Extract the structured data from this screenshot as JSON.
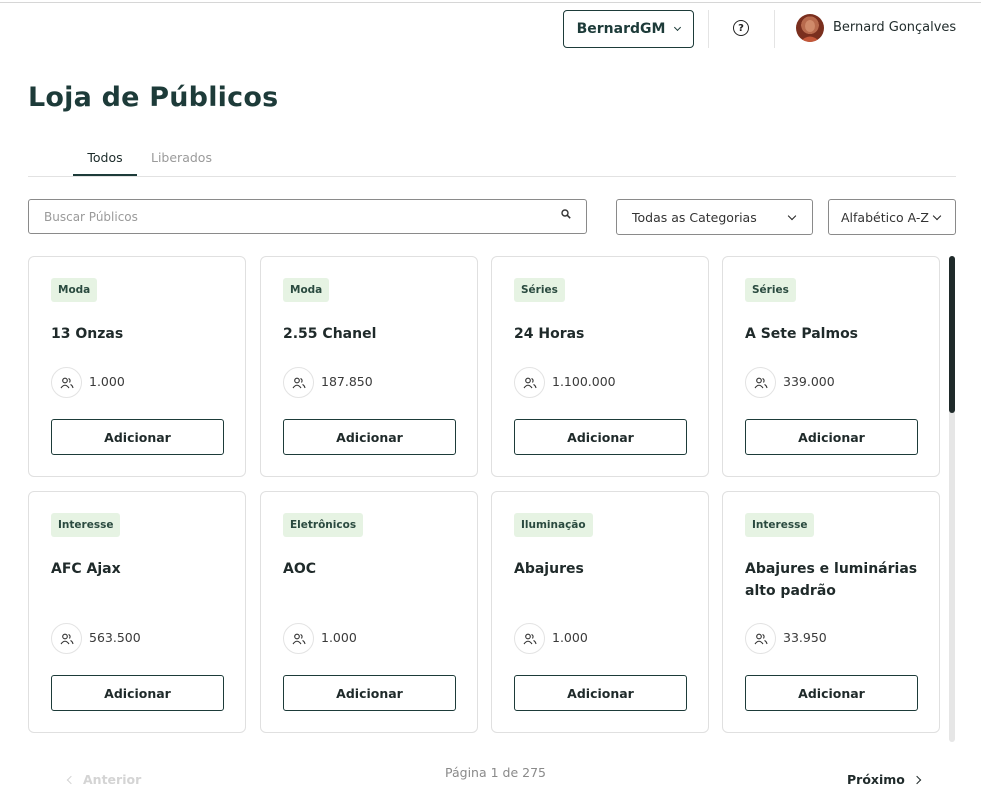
{
  "header": {
    "account": "BernardGM",
    "help_glyph": "?",
    "user_name": "Bernard Gonçalves"
  },
  "page_title": "Loja de Públicos",
  "tabs": [
    {
      "label": "Todos",
      "active": true
    },
    {
      "label": "Liberados",
      "active": false
    }
  ],
  "filters": {
    "search_placeholder": "Buscar Públicos",
    "category": "Todas as Categorias",
    "sort": "Alfabético A-Z"
  },
  "cards": [
    {
      "category": "Moda",
      "title": "13 Onzas",
      "count": "1.000",
      "button": "Adicionar"
    },
    {
      "category": "Moda",
      "title": "2.55 Chanel",
      "count": "187.850",
      "button": "Adicionar"
    },
    {
      "category": "Séries",
      "title": "24 Horas",
      "count": "1.100.000",
      "button": "Adicionar"
    },
    {
      "category": "Séries",
      "title": "A Sete Palmos",
      "count": "339.000",
      "button": "Adicionar"
    },
    {
      "category": "Interesse",
      "title": "AFC Ajax",
      "count": "563.500",
      "button": "Adicionar"
    },
    {
      "category": "Eletrônicos",
      "title": "AOC",
      "count": "1.000",
      "button": "Adicionar"
    },
    {
      "category": "Iluminação",
      "title": "Abajures",
      "count": "1.000",
      "button": "Adicionar"
    },
    {
      "category": "Interesse",
      "title": "Abajures e luminárias alto padrão",
      "count": "33.950",
      "button": "Adicionar"
    }
  ],
  "pagination": {
    "prev": "Anterior",
    "info": "Página 1 de 275",
    "next": "Próximo"
  },
  "colors": {
    "primary": "#1d3b39",
    "badge_bg": "#e6f3e3",
    "badge_text": "#2a4a3f",
    "muted": "#9a9a9a"
  }
}
